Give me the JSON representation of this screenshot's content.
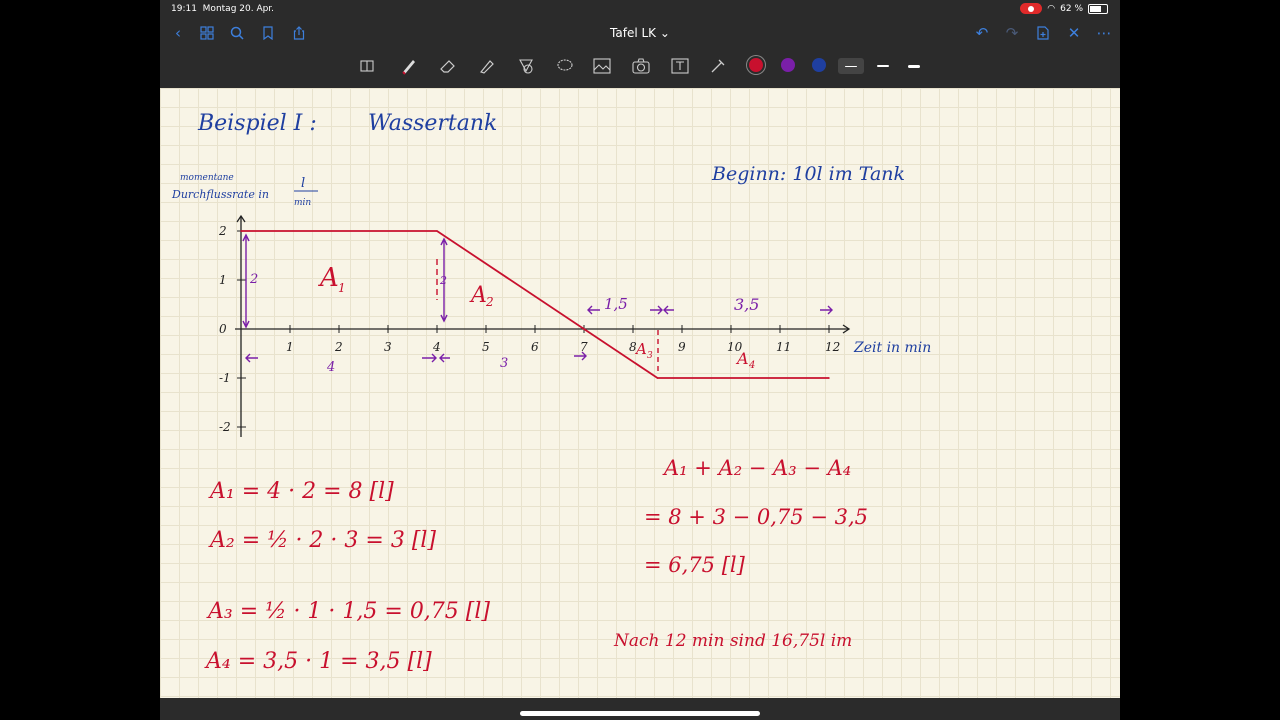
{
  "status": {
    "time": "19:11",
    "date": "Montag 20. Apr.",
    "battery": "62 %"
  },
  "nav": {
    "title": "Tafel LK ⌄"
  },
  "icons": {
    "back": "chevron-left-icon",
    "grid": "grid-icon",
    "search": "search-icon",
    "bookmark": "bookmark-icon",
    "share": "share-icon",
    "undo": "undo-icon",
    "redo": "redo-icon",
    "add_page": "add-page-icon",
    "close": "close-icon",
    "more": "more-icon"
  },
  "colors": {
    "pen_red": "#c8102e",
    "pen_purple": "#7a1fa8",
    "pen_blue": "#1f3fa0",
    "accent": "#3d7fdc"
  },
  "note": {
    "heading_left": "Beispiel I :",
    "heading_right": "Wassertank",
    "begin": "Beginn: 10l im Tank",
    "ylabel_1": "momentane",
    "ylabel_2": "Durchflussrate in",
    "ylabel_unit_top": "l",
    "ylabel_unit_bottom": "min",
    "xlabel": "Zeit in min",
    "area_A1": "A",
    "area_A1_sub": "1",
    "area_A2": "A",
    "area_A2_sub": "2",
    "area_A3": "A",
    "area_A3_sub": "3",
    "area_A4": "A",
    "area_A4_sub": "4",
    "mark_2a": "2",
    "mark_2b": "2",
    "mark_4": "4",
    "mark_3": "3",
    "mark_15": "1,5",
    "mark_35": "3,5",
    "eq_A1": "A₁ = 4 · 2   = 8   [l]",
    "eq_A2": "A₂ = ½ · 2 · 3   = 3   [l]",
    "eq_A3": "A₃ = ½ · 1 · 1,5 = 0,75 [l]",
    "eq_A4": "A₄ = 3,5 · 1   = 3,5  [l]",
    "sum_1": "A₁ + A₂  − A₃  − A₄",
    "sum_2": "= 8 + 3  − 0,75 − 3,5",
    "sum_3": "= 6,75  [l]",
    "conclusion": "Nach 12 min sind 16,75l im"
  },
  "chart_data": {
    "type": "line",
    "title": "",
    "xlabel": "Zeit in min",
    "ylabel": "momentane Durchflussrate in l/min",
    "xlim": [
      0,
      12
    ],
    "ylim": [
      -2,
      2
    ],
    "x_ticks": [
      "1",
      "2",
      "3",
      "4",
      "5",
      "6",
      "7",
      "8",
      "9",
      "10",
      "11",
      "12"
    ],
    "y_ticks": [
      "-2",
      "-1",
      "0",
      "1",
      "2"
    ],
    "x": [
      0,
      4,
      7,
      8.5,
      12
    ],
    "series": [
      {
        "values": [
          2,
          2,
          0,
          -1,
          -1
        ]
      }
    ]
  }
}
